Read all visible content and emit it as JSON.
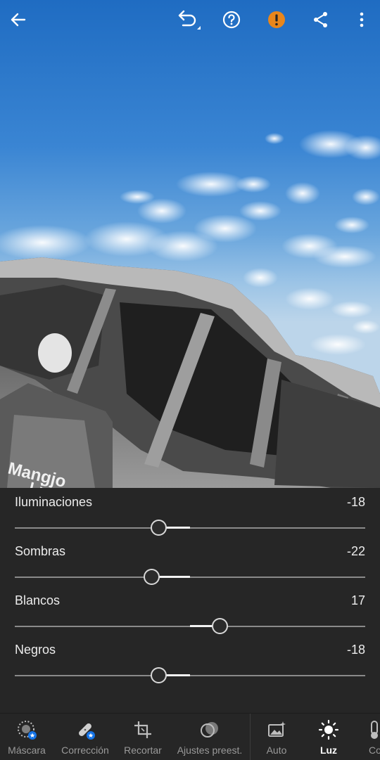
{
  "topbar": {
    "back_icon": "arrow-left-icon",
    "undo_icon": "undo-icon",
    "help_icon": "help-circle-icon",
    "warning_icon": "warning-icon",
    "warning_color": "#e8861b",
    "share_icon": "share-icon",
    "more_icon": "more-vertical-icon"
  },
  "photo": {
    "bag_text_line1": "Mangjo",
    "bag_text_line2": "Liso"
  },
  "adjustments": [
    {
      "label": "Iluminaciones",
      "value": "-18",
      "level": -18
    },
    {
      "label": "Sombras",
      "value": "-22",
      "level": -22
    },
    {
      "label": "Blancos",
      "value": "17",
      "level": 17
    },
    {
      "label": "Negros",
      "value": "-18",
      "level": -18
    }
  ],
  "slider_range": [
    -100,
    100
  ],
  "toolbar": {
    "items": [
      {
        "label": "Máscara",
        "icon": "mask-icon",
        "badge": "star-badge"
      },
      {
        "label": "Corrección",
        "icon": "healing-bandage-icon",
        "badge": "star-badge"
      },
      {
        "label": "Recortar",
        "icon": "crop-icon"
      },
      {
        "label": "Ajustes preest.",
        "icon": "presets-icon"
      },
      {
        "label": "Auto",
        "icon": "auto-icon"
      },
      {
        "label": "Luz",
        "icon": "sun-icon",
        "active": true
      },
      {
        "label": "Co",
        "icon": "color-thermometer-icon"
      }
    ],
    "badge_color": "#1473e6"
  }
}
